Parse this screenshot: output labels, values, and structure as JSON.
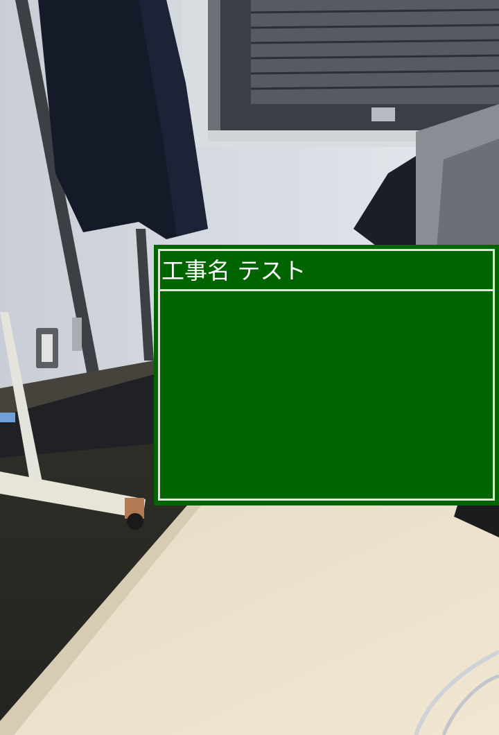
{
  "blackboard": {
    "title_label": "工事名",
    "project_name": "テスト",
    "background_color": "#006400",
    "border_color": "#dfe9d8",
    "text_color": "#ffffff"
  },
  "camera_photo": {
    "description_icon": "room-photo"
  }
}
